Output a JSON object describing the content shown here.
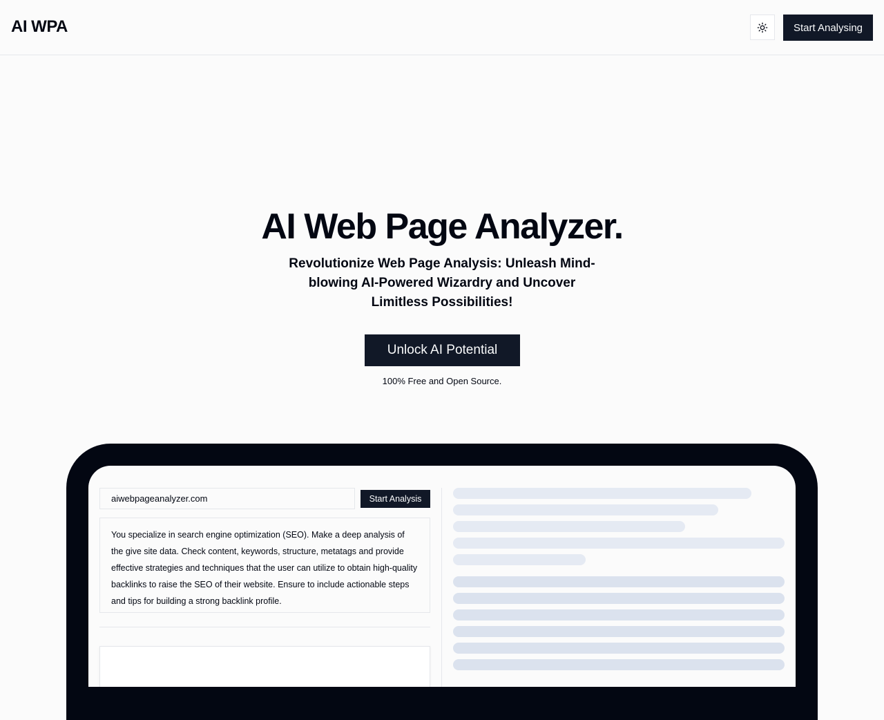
{
  "header": {
    "logo": "AI WPA",
    "theme_toggle_icon": "sun-icon",
    "start_label": "Start Analysing"
  },
  "hero": {
    "title": "AI Web Page Analyzer.",
    "subtitle": "Revolutionize Web Page Analysis: Unleash Mind-blowing AI-Powered Wizardry and Uncover Limitless Possibilities!",
    "cta_label": "Unlock AI Potential",
    "note": "100% Free and Open Source."
  },
  "demo": {
    "url_value": "aiwebpageanalyzer.com",
    "analysis_label": "Start Analysis",
    "prompt": "You specialize in search engine optimization (SEO). Make a deep analysis of the give site data. Check content, keywords, structure, metatags and provide effective strategies and techniques that the user can utilize to obtain high-quality backlinks to raise the SEO of their website. Ensure to include actionable steps and tips for building a strong backlink profile."
  },
  "colors": {
    "primary": "#111827",
    "text": "#030712",
    "device_frame": "#030712",
    "border": "#e5e7eb",
    "skeleton_light": "#e5eaf3",
    "skeleton_dark": "#dbe2ee"
  }
}
